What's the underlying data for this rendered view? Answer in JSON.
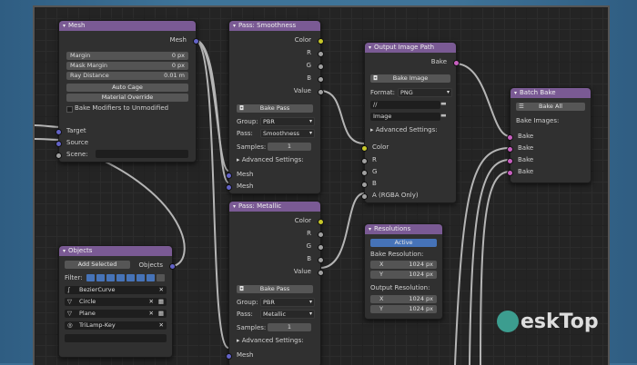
{
  "nodes": {
    "mesh": {
      "title": "Mesh",
      "out": "Mesh",
      "margin_label": "Margin",
      "margin": "0 px",
      "mask_label": "Mask Margin",
      "mask": "0 px",
      "ray_label": "Ray Distance",
      "ray": "0.01 m",
      "auto_cage": "Auto Cage",
      "mat_override": "Material Override",
      "bake_mod": "Bake Modifiers to Unmodified",
      "target": "Target",
      "source": "Source",
      "scene": "Scene:"
    },
    "smoothness": {
      "title": "Pass: Smoothness",
      "color": "Color",
      "r": "R",
      "g": "G",
      "b": "B",
      "value": "Value",
      "bake_pass": "Bake Pass",
      "group_label": "Group:",
      "group": "PBR",
      "pass_label": "Pass:",
      "pass": "Smoothness",
      "samples_label": "Samples:",
      "samples": "1",
      "adv": "Advanced Settings:",
      "mesh1": "Mesh",
      "mesh2": "Mesh"
    },
    "metallic": {
      "title": "Pass: Metallic",
      "color": "Color",
      "r": "R",
      "g": "G",
      "b": "B",
      "value": "Value",
      "bake_pass": "Bake Pass",
      "group_label": "Group:",
      "group": "PBR",
      "pass_label": "Pass:",
      "pass": "Metallic",
      "samples_label": "Samples:",
      "samples": "1",
      "adv": "Advanced Settings:",
      "mesh": "Mesh"
    },
    "output": {
      "title": "Output Image Path",
      "bake": "Bake",
      "bake_image": "Bake Image",
      "format_label": "Format:",
      "format": "PNG",
      "path": "//",
      "name": "Image",
      "adv": "Advanced Settings:",
      "color": "Color",
      "r": "R",
      "g": "G",
      "b": "B",
      "a": "A (RGBA Only)"
    },
    "resolutions": {
      "title": "Resolutions",
      "active": "Active",
      "bake_res": "Bake Resolution:",
      "x_label": "X",
      "x": "1024 px",
      "y_label": "Y",
      "y": "1024 px",
      "out_res": "Output Resolution:",
      "ox": "1024 px",
      "oy": "1024 px"
    },
    "batch": {
      "title": "Batch Bake",
      "bake_all": "Bake All",
      "images": "Bake Images:",
      "b1": "Bake",
      "b2": "Bake",
      "b3": "Bake",
      "b4": "Bake"
    },
    "objects": {
      "title": "Objects",
      "add": "Add Selected",
      "out": "Objects",
      "filter": "Filter:",
      "items": [
        "BezierCurve",
        "Circle",
        "Plane",
        "TriLamp-Key"
      ]
    }
  },
  "watermark": "eskTop"
}
